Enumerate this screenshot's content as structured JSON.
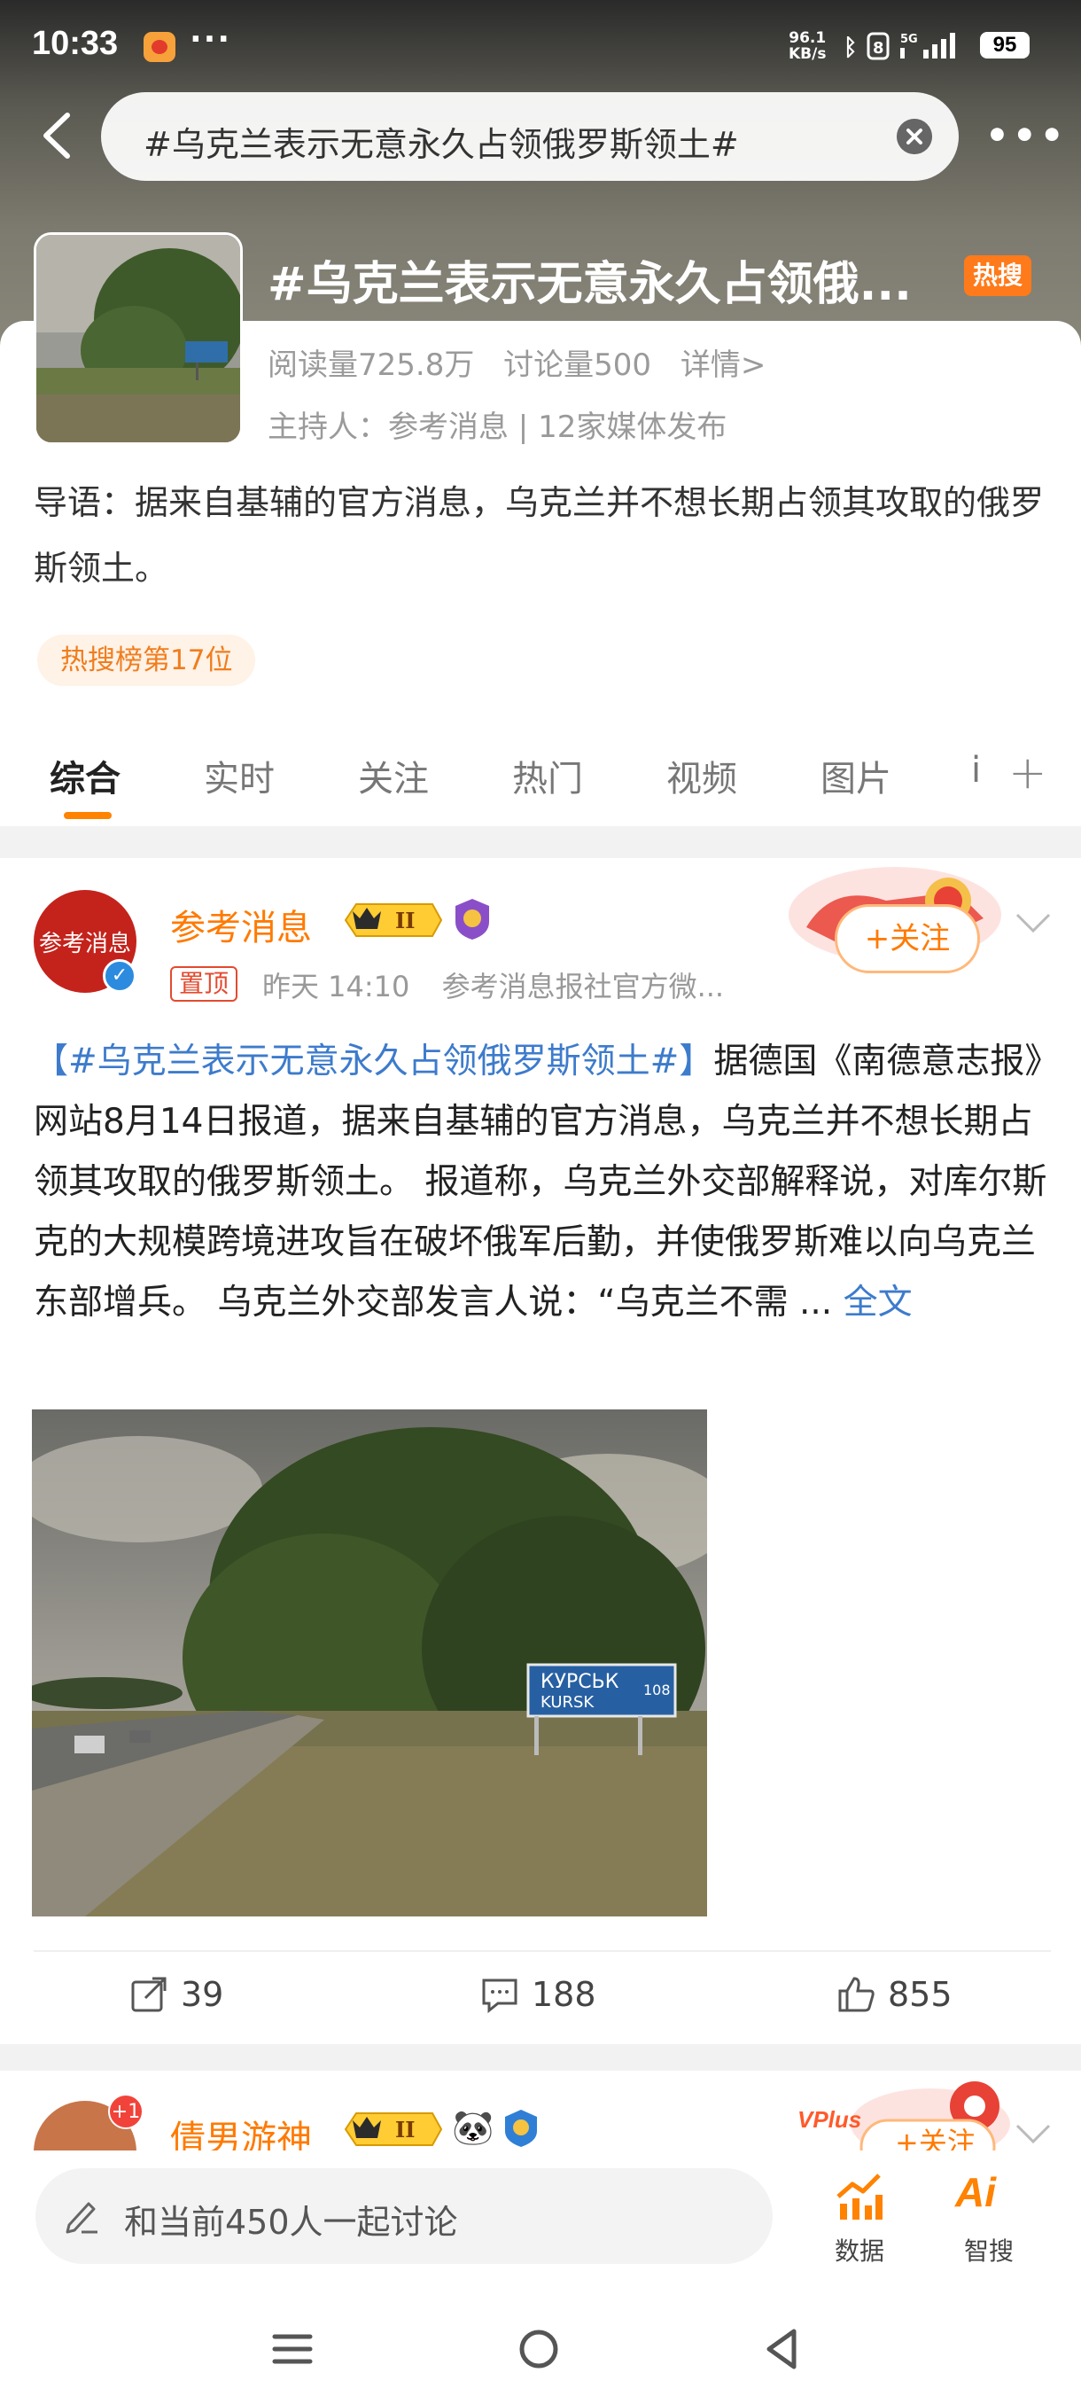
{
  "status_bar": {
    "time": "10:33",
    "dots": "···",
    "net_speed": "96.1",
    "net_unit": "KB/s",
    "battery": "95"
  },
  "search": {
    "query": "#乌克兰表示无意永久占领俄罗斯领土#"
  },
  "topic": {
    "title": "#乌克兰表示无意永久占领俄...",
    "hot_badge": "热搜",
    "reads": "阅读量725.8万",
    "discussions": "讨论量500",
    "details": "详情>",
    "host": "主持人：参考消息 | 12家媒体发布",
    "intro": "导语：据来自基辅的官方消息，乌克兰并不想长期占领其攻取的俄罗斯领土。",
    "rank": "热搜榜第17位"
  },
  "tabs": [
    {
      "label": "综合",
      "active": true
    },
    {
      "label": "实时",
      "active": false
    },
    {
      "label": "关注",
      "active": false
    },
    {
      "label": "热门",
      "active": false
    },
    {
      "label": "视频",
      "active": false
    },
    {
      "label": "图片",
      "active": false
    },
    {
      "label": "i",
      "active": false
    }
  ],
  "post1": {
    "avatar_text": "参考消息",
    "author": "参考消息",
    "vip_level": "II",
    "pinned": "置顶",
    "time": "昨天 14:10",
    "source": "参考消息报社官方微...",
    "follow": "+关注",
    "hashtag": "【#乌克兰表示无意永久占领俄罗斯领土#】",
    "body": "据德国《南德意志报》网站8月14日报道，据来自基辅的官方消息，乌克兰并不想长期占领其攻取的俄罗斯领土。 报道称，乌克兰外交部解释说，对库尔斯克的大规模跨境进攻旨在破坏俄军后勤，并使俄罗斯难以向乌克兰东部增兵。 乌克兰外交部发言人说：“乌克兰不需 ... ",
    "full_text": "全文",
    "image_sign": {
      "line1": "КУРСЬК",
      "line2": "KURSK",
      "number": "108"
    },
    "reposts": "39",
    "comments": "188",
    "likes": "855"
  },
  "post2": {
    "author": "倩男游神",
    "vip_level": "II",
    "avatar_badge": "+1",
    "follow": "+关注",
    "deco_text": "VPlus"
  },
  "bottom_bar": {
    "discuss_placeholder": "和当前450人一起讨论",
    "data_label": "数据",
    "ai_label": "智搜",
    "ai_icon": "Ai"
  },
  "colors": {
    "accent": "#ff8200",
    "link": "#3d7bcc",
    "hot_badge": "#ff7a1a"
  },
  "icons": [
    "back-icon",
    "clear-icon",
    "more-icon",
    "verified-icon",
    "share-icon",
    "comment-icon",
    "like-icon",
    "edit-icon",
    "chart-icon",
    "menu-icon",
    "home-icon",
    "back-nav-icon"
  ]
}
